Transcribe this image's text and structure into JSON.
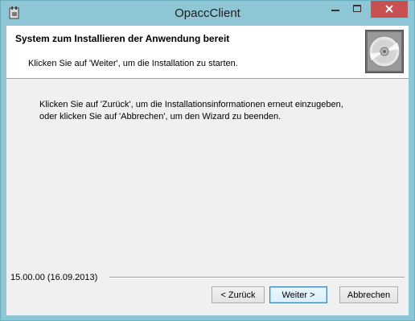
{
  "window": {
    "title": "OpaccClient",
    "icon": "installer-app-icon",
    "controls": [
      "minimize-icon",
      "maximize-icon",
      "close-icon"
    ],
    "accent_color": "#8ec6d6",
    "close_color": "#c75050"
  },
  "header": {
    "title": "System zum Installieren der Anwendung bereit",
    "subtitle": "Klicken Sie auf 'Weiter', um die Installation zu starten.",
    "icon": "cd-disc-icon"
  },
  "body": {
    "line1": "Klicken Sie auf 'Zurück', um die Installationsinformationen erneut einzugeben,",
    "line2": "oder klicken Sie auf 'Abbrechen', um den Wizard zu beenden."
  },
  "footer": {
    "version": "15.00.00 (16.09.2013)",
    "back_label": "< Zurück",
    "next_label": "Weiter >",
    "cancel_label": "Abbrechen"
  }
}
